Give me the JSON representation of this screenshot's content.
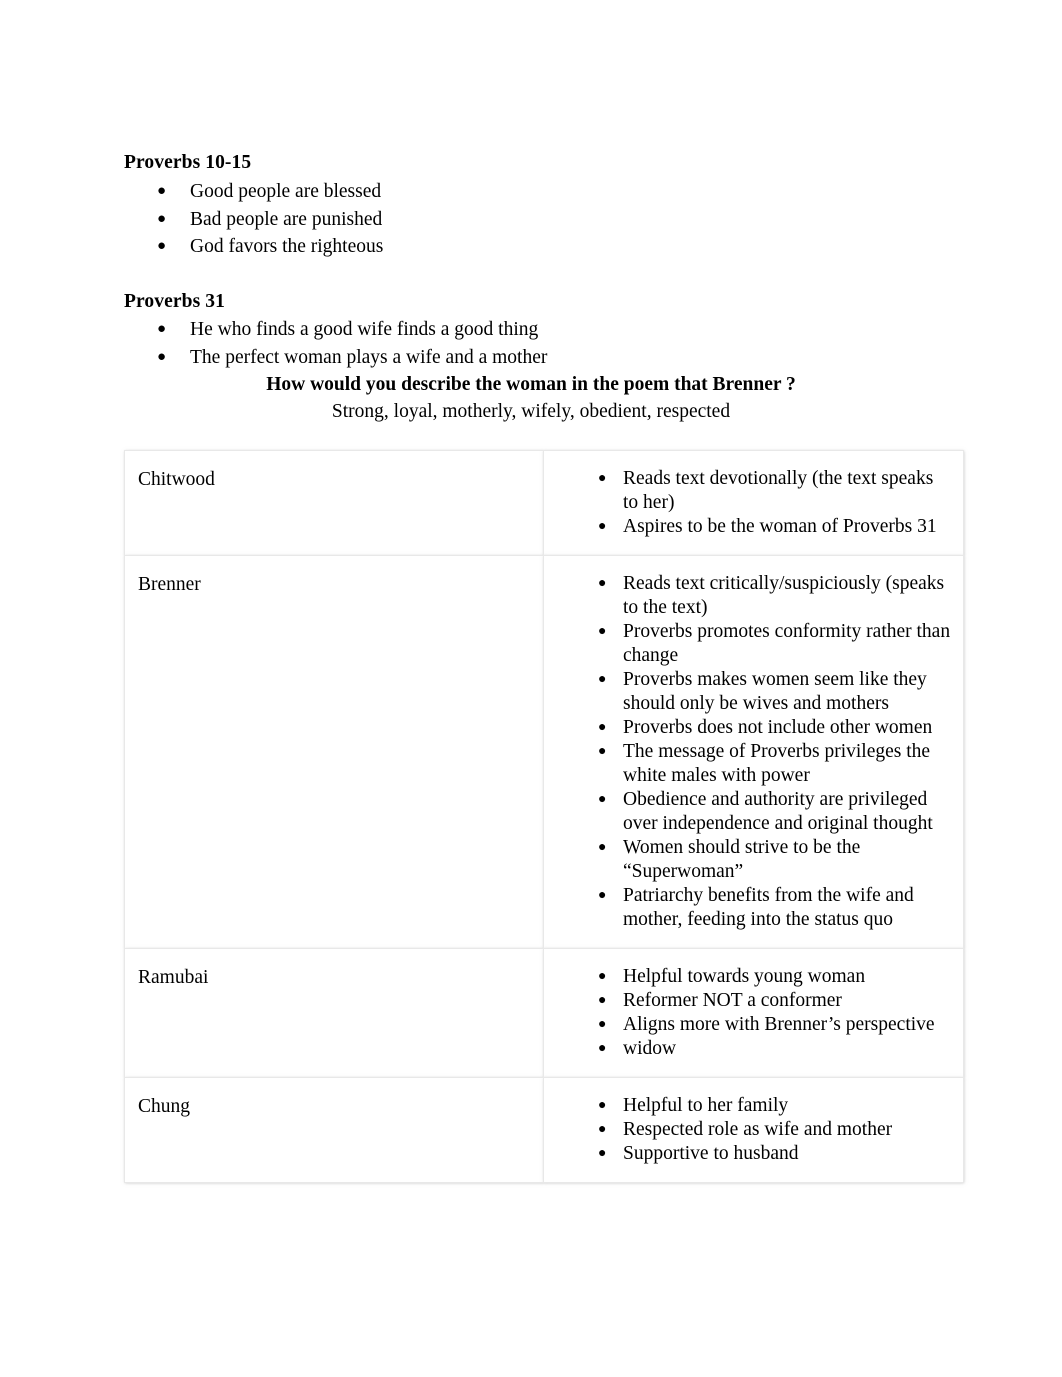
{
  "document": {
    "sections": [
      {
        "heading": "Proverbs 10-15",
        "bullets": [
          "Good people are blessed",
          "Bad people are punished",
          "God favors the righteous"
        ]
      },
      {
        "heading": "Proverbs 31",
        "bullets": [
          "He who finds a good wife finds a good thing",
          "The perfect woman plays a wife and a mother"
        ]
      }
    ],
    "question": "How would you describe the woman in the poem that Brenner ?",
    "answer": "Strong, loyal, motherly, wifely, obedient, respected",
    "table": {
      "rows": [
        {
          "name": "Chitwood",
          "points": [
            "Reads text devotionally (the text speaks to her)",
            "Aspires to be the woman of Proverbs 31"
          ]
        },
        {
          "name": "Brenner",
          "points": [
            "Reads text critically/suspiciously (speaks to the text)",
            "Proverbs promotes conformity rather than change",
            "Proverbs makes women seem like they should only be wives and mothers",
            "Proverbs does not include other women",
            "The message of Proverbs privileges the white males with power",
            "Obedience and authority are privileged over independence and original thought",
            "Women should strive to be the “Superwoman”",
            "Patriarchy benefits from the wife and mother, feeding into the status quo"
          ]
        },
        {
          "name": "Ramubai",
          "points": [
            "Helpful towards young woman",
            "Reformer NOT a conformer",
            "Aligns more with Brenner’s perspective",
            "widow"
          ]
        },
        {
          "name": "Chung",
          "points": [
            "Helpful to her family",
            "Respected role as wife and mother",
            "Supportive to husband"
          ]
        }
      ]
    },
    "bullet_glyph": "●"
  }
}
